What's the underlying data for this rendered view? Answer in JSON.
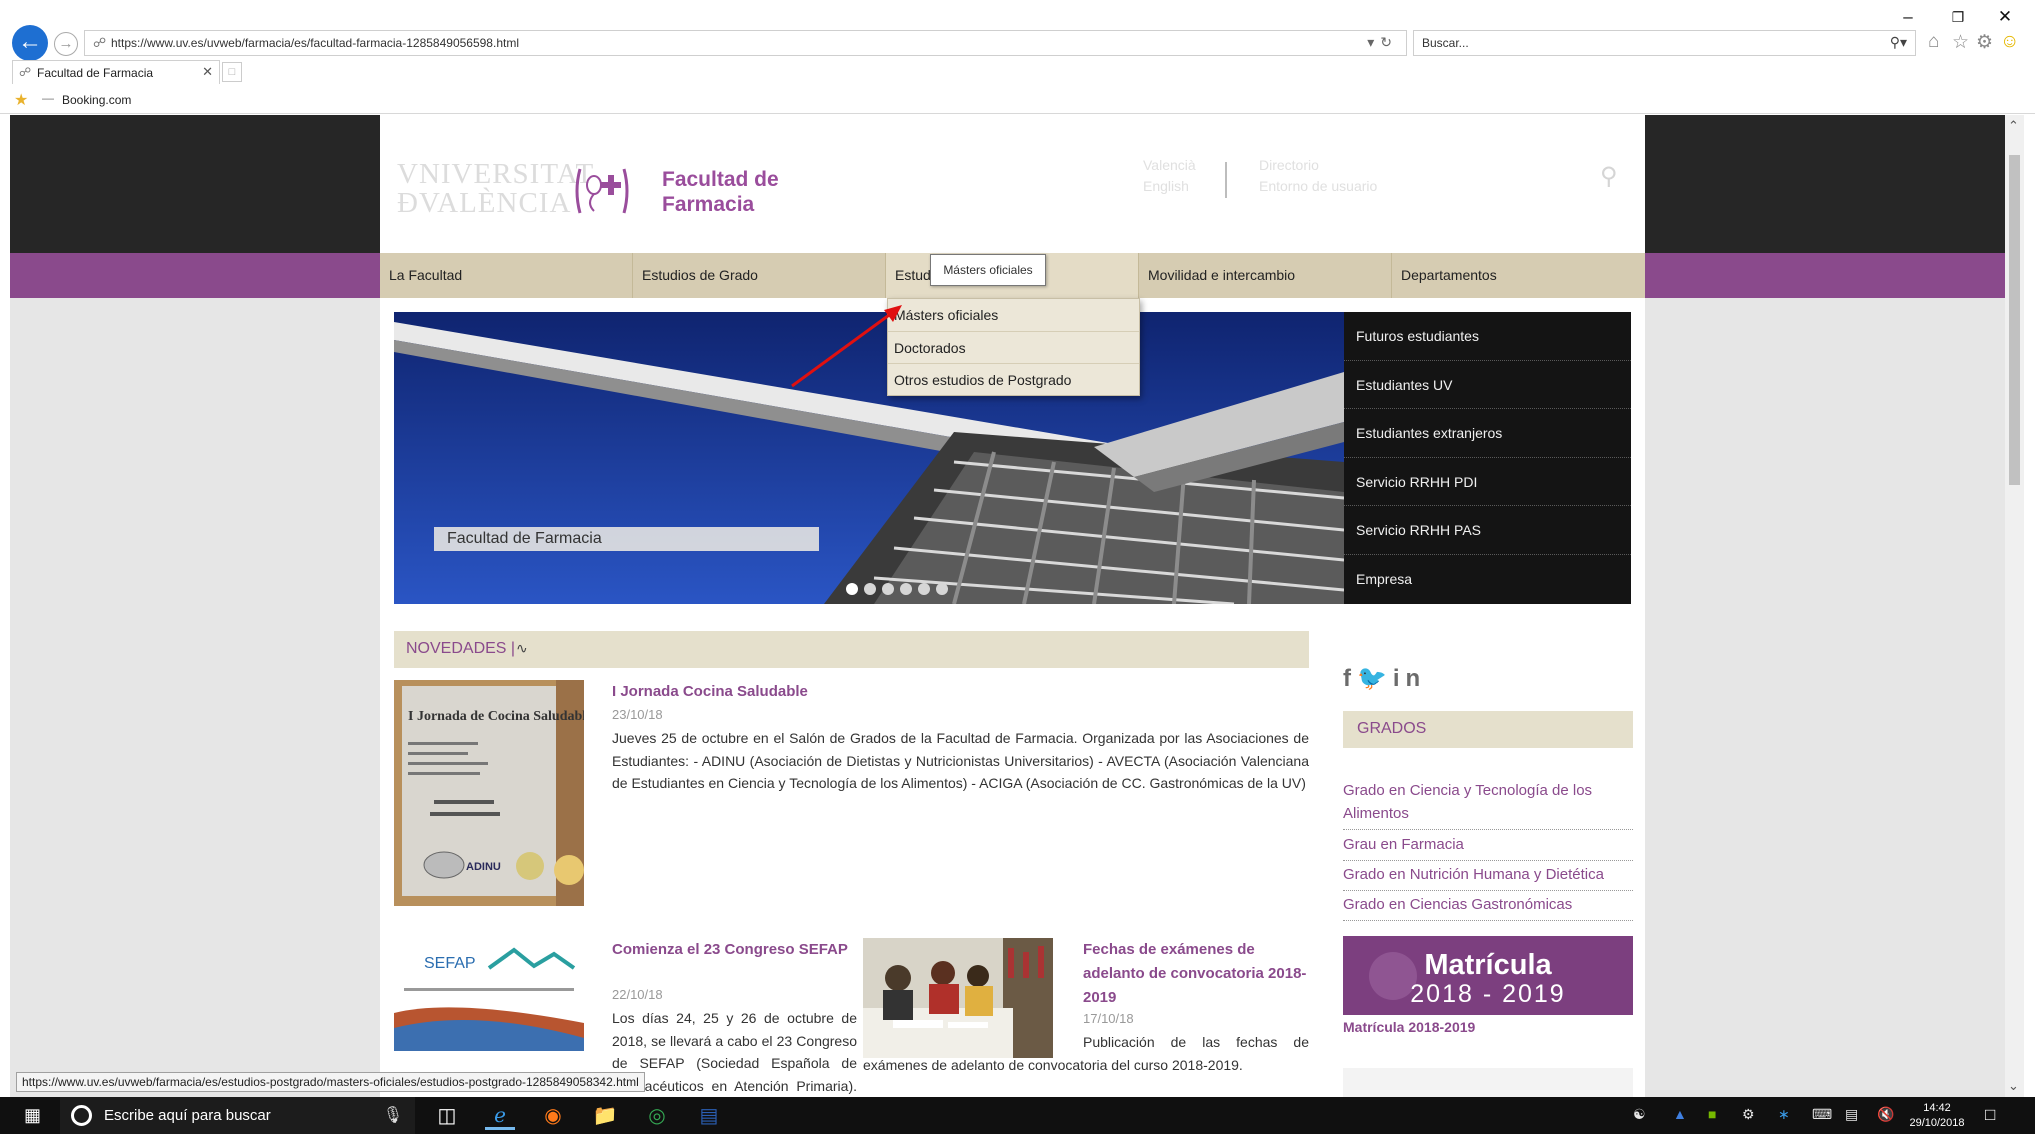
{
  "browser": {
    "url": "https://www.uv.es/uvweb/farmacia/es/facultad-farmacia-1285849056598.html",
    "search_placeholder": "Buscar...",
    "tab_title": "Facultad de Farmacia",
    "favorites": [
      {
        "label": "Booking.com"
      }
    ],
    "window_controls": [
      "–",
      "❐",
      "✕"
    ]
  },
  "site": {
    "logo_line1": "VNIVERSITAT",
    "logo_line2": "ÐVALÈNCIA",
    "faculty_line1": "Facultad de",
    "faculty_line2": "Farmacia",
    "top_links": {
      "valencia": "Valencià",
      "english": "English",
      "directorio": "Directorio",
      "entorno": "Entorno de usuario"
    },
    "search_value": ""
  },
  "nav": {
    "items": [
      {
        "label": "La Facultad"
      },
      {
        "label": "Estudios de Grado"
      },
      {
        "label": "Estud"
      },
      {
        "label": "Movilidad e intercambio"
      },
      {
        "label": "Departamentos"
      }
    ]
  },
  "dropdown": {
    "items": [
      {
        "label": "Másters oficiales"
      },
      {
        "label": "Doctorados"
      },
      {
        "label": "Otros estudios de Postgrado"
      }
    ],
    "tooltip": "Másters oficiales"
  },
  "hero": {
    "caption": "Facultad de Farmacia",
    "dots": 6,
    "active_dot": 0
  },
  "audience": {
    "items": [
      {
        "label": "Futuros estudiantes"
      },
      {
        "label": "Estudiantes UV"
      },
      {
        "label": "Estudiantes extranjeros"
      },
      {
        "label": "Servicio RRHH PDI"
      },
      {
        "label": "Servicio RRHH PAS"
      },
      {
        "label": "Empresa"
      }
    ]
  },
  "novedades": {
    "title": "NOVEDADES",
    "sep": "|",
    "news": [
      {
        "title": "I Jornada Cocina Saludable",
        "date": "23/10/18",
        "body": "Jueves 25 de octubre en el Salón de Grados de la Facultad de Farmacia. Organizada por las Asociaciones de Estudiantes: - ADINU (Asociación de Dietistas y Nutricionistas Universitarios) - AVECTA (Asociación Valenciana de Estudiantes en Ciencia y Tecnología de los Alimentos) - ACIGA (Asociación de CC. Gastronómicas de la UV)"
      },
      {
        "title": "Comienza el 23 Congreso SEFAP",
        "date": "22/10/18",
        "body": "Los días 24, 25 y 26 de octubre de 2018, se llevará a cabo el 23 Congreso de SEFAP (Sociedad Española de Farmacéuticos en Atención Primaria). “Hacia un proceso"
      },
      {
        "title": "Fechas de exámenes de adelanto de convocatoria 2018-2019",
        "date": "17/10/18",
        "body": "Publicación de las fechas de exámenes de adelanto de convocatoria del curso 2018-2019."
      }
    ],
    "poster_title": "I Jornada de Cocina Saludable",
    "poster_brand": "ADINU",
    "sefap_logo": "SEFAP"
  },
  "sidebar": {
    "social": [
      "f",
      "t",
      "in"
    ],
    "grados_title": "GRADOS",
    "grados": [
      {
        "label": "Grado en Ciencia y Tecnología de los Alimentos"
      },
      {
        "label": "Grau en Farmacia"
      },
      {
        "label": "Grado en Nutrición Humana y Dietética"
      },
      {
        "label": "Grado en Ciencias Gastronómicas"
      }
    ],
    "matricula_banner_1": "Matrícula",
    "matricula_banner_2": "2018 - 2019",
    "matricula_link": "Matrícula 2018-2019"
  },
  "status_bar_url": "https://www.uv.es/uvweb/farmacia/es/estudios-postgrado/masters-oficiales/estudios-postgrado-1285849058342.html",
  "taskbar": {
    "search_placeholder": "Escribe aquí para buscar",
    "time": "14:42",
    "date": "29/10/2018"
  },
  "colors": {
    "accent_purple": "#8a4a8c",
    "nav_beige": "#d6ccb2",
    "header_dark": "#262626",
    "link_purple": "#8a4a8c"
  }
}
